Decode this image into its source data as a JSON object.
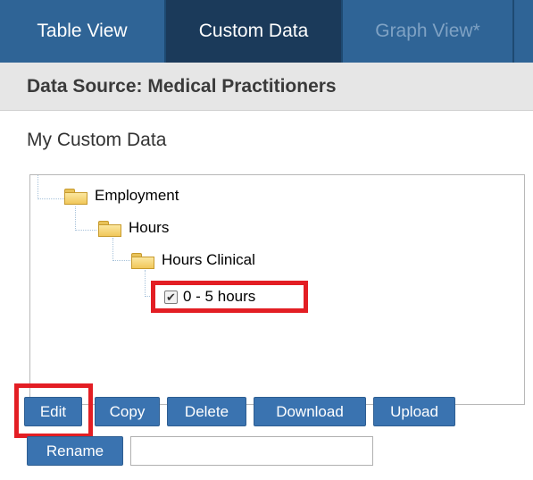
{
  "tabs": [
    {
      "label": "Table View"
    },
    {
      "label": "Custom Data"
    },
    {
      "label": "Graph View*"
    }
  ],
  "source": {
    "title": "Data Source: Medical Practitioners"
  },
  "heading": "My Custom Data",
  "tree": {
    "nodes": [
      {
        "label": "Employment"
      },
      {
        "label": "Hours"
      },
      {
        "label": "Hours Clinical"
      }
    ],
    "leaf": {
      "label": "0 - 5 hours",
      "checked": true
    }
  },
  "buttons": {
    "edit": "Edit",
    "copy": "Copy",
    "delete": "Delete",
    "download": "Download",
    "upload": "Upload",
    "rename": "Rename"
  },
  "rename_input": {
    "value": ""
  },
  "colors": {
    "tab_bar": "#2f6496",
    "active_tab": "#1b3a5a",
    "button": "#3a73b0",
    "highlight": "#e31e24"
  }
}
